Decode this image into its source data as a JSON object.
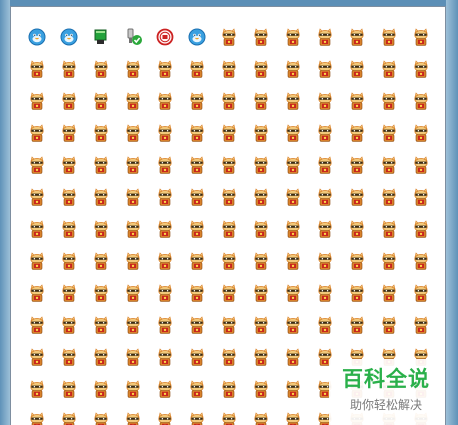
{
  "window": {
    "frame_color": "#5c8fb6",
    "background": "#ffffff"
  },
  "grid": {
    "columns": 13,
    "rows": 13,
    "first_row": [
      {
        "icon": "qq-penguin-icon",
        "color": "#3aa0e0"
      },
      {
        "icon": "qq-penguin-icon",
        "color": "#3aa0e0"
      },
      {
        "icon": "green-monitor-icon",
        "color": "#22a33a"
      },
      {
        "icon": "usb-plug-check-icon",
        "color": "#707070"
      },
      {
        "icon": "red-stamp-icon",
        "color": "#cc2222"
      },
      {
        "icon": "qq-penguin-icon",
        "color": "#3aa0e0"
      },
      {
        "icon": "lucky-cat-icon"
      },
      {
        "icon": "lucky-cat-icon"
      },
      {
        "icon": "lucky-cat-icon"
      },
      {
        "icon": "lucky-cat-icon"
      },
      {
        "icon": "lucky-cat-icon"
      },
      {
        "icon": "lucky-cat-icon"
      },
      {
        "icon": "lucky-cat-icon"
      }
    ],
    "filler_icon": "lucky-cat-icon",
    "colors": {
      "cat_body": "#d9822b",
      "cat_face": "#f2c879",
      "cat_mask": "#3b2a12",
      "cat_red": "#c8261e"
    }
  },
  "watermark": {
    "title": "百科全说",
    "subtitle": "助你轻松解决",
    "title_color": "#2ab04a"
  }
}
